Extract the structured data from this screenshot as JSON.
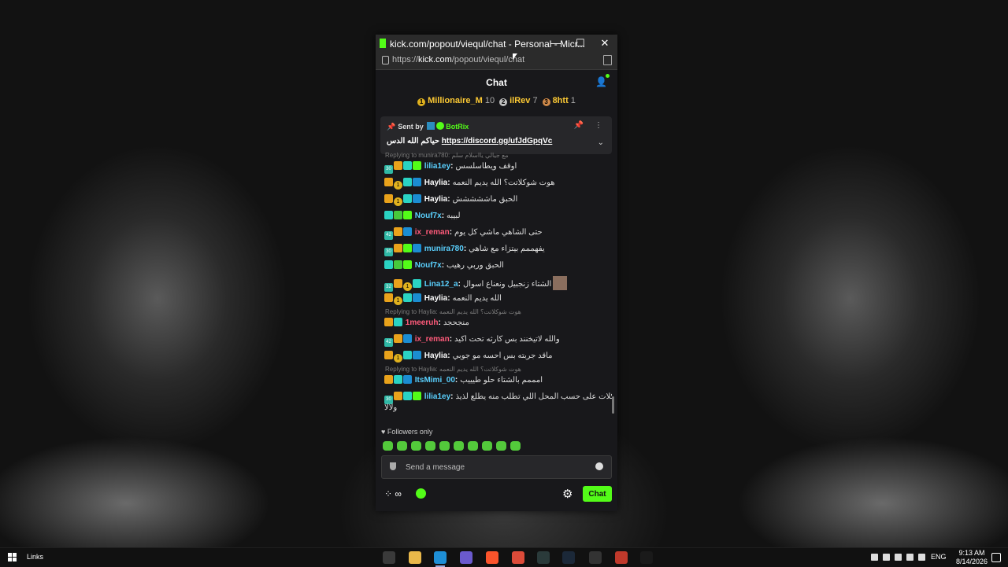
{
  "window": {
    "title": "kick.com/popout/viequl/chat - Personal - Micr...",
    "url_prefix": "https://",
    "url_host": "kick.com",
    "url_path": "/popout/viequl/chat",
    "minimize": "—",
    "maximize": "☐",
    "close": "✕"
  },
  "chat": {
    "title": "Chat",
    "leaderboard": [
      {
        "rank": "1",
        "name": "Millionaire_M",
        "count": "10",
        "color": "#e0b11e"
      },
      {
        "rank": "2",
        "name": "ilRev",
        "count": "7",
        "color": "#c0c0c0"
      },
      {
        "rank": "3",
        "name": "8htt",
        "count": "1",
        "color": "#d08a4a"
      }
    ],
    "pinned": {
      "sent_by": "Sent by",
      "bot": "BotRix",
      "text": "حياكم الله الدس",
      "link": "https://discord.gg/ufJdGpqVc"
    },
    "messages": [
      {
        "reply": "Replying to munira780: مع جيالي يااسلام سلم",
        "user": "lilia1ey",
        "color": "#5ad1ff",
        "text": "اوقف ويطاسلسس",
        "badges": [
          "sub30",
          "crown",
          "gift",
          "vip"
        ]
      },
      {
        "user": "Haylia",
        "color": "#ffffff",
        "text": "هوت شوكلاتت؟ الله يديم النعمه",
        "badges": [
          "crown",
          "num1",
          "gift",
          "mod"
        ]
      },
      {
        "user": "Haylia",
        "color": "#ffffff",
        "text": "الحبق ماششششش",
        "badges": [
          "crown",
          "num1",
          "gift",
          "mod"
        ]
      },
      {
        "user": "Nouf7x",
        "color": "#5ad1ff",
        "text": "لبيبه",
        "badges": [
          "gift",
          "green",
          "vip"
        ]
      },
      {
        "user": "ix_reman",
        "color": "#ff5a7a",
        "text": "حتى الشاهي ماشي كل يوم",
        "badges": [
          "sub42",
          "crown",
          "mod"
        ]
      },
      {
        "user": "munira780",
        "color": "#5ad1ff",
        "text": "يفهممم بيتزاء مع شاهي",
        "badges": [
          "sub30",
          "crown",
          "vip",
          "mod"
        ]
      },
      {
        "user": "Nouf7x",
        "color": "#5ad1ff",
        "text": "الحبق وربي رهيب",
        "badges": [
          "gift",
          "green",
          "vip"
        ]
      },
      {
        "user": "Lina12_a",
        "color": "#5ad1ff",
        "text": "الشتاء زنجبيل ونعناع اسوال",
        "badges": [
          "sub32",
          "crown",
          "num1",
          "gift"
        ]
      },
      {
        "user": "Haylia",
        "color": "#ffffff",
        "text": "الله يديم النعمه",
        "badges": [
          "crown",
          "num1",
          "gift",
          "mod"
        ]
      },
      {
        "reply": "Replying to Haylia: هوت شوكلاتت؟ الله يديم النعمه",
        "user": "1meeruh",
        "color": "#ff5a7a",
        "text": "منجحجد",
        "badges": [
          "crown",
          "gift"
        ]
      },
      {
        "user": "ix_reman",
        "color": "#ff5a7a",
        "text": "والله لاتيخنند بس كارثه تحت اكيد",
        "badges": [
          "sub42",
          "crown",
          "mod"
        ]
      },
      {
        "user": "Haylia",
        "color": "#ffffff",
        "text": "ماقد جربته بس احسه مو جوبي",
        "badges": [
          "crown",
          "num1",
          "gift",
          "mod"
        ]
      },
      {
        "reply": "Replying to Haylia: هوت شوكلاتت؟ الله يديم النعمه",
        "user": "ItsMimi_00",
        "color": "#5ad1ff",
        "text": "امممم بالشتاء حلو طيييب",
        "badges": [
          "crown",
          "gift",
          "mod"
        ]
      },
      {
        "user": "lilia1ey",
        "color": "#5ad1ff",
        "text": "هوت شوكلات على حسب المحل اللي تطلب منه يطلع لذيذ",
        "badges": [
          "sub30",
          "crown",
          "gift",
          "vip"
        ],
        "cont": "ولالا"
      }
    ],
    "followers_only": "Followers only",
    "input_placeholder": "Send a message",
    "points": "∞",
    "send_button": "Chat"
  },
  "taskbar": {
    "links": "Links",
    "lang": "ENG",
    "time": "9:13 AM",
    "date": "8/14/2026"
  }
}
